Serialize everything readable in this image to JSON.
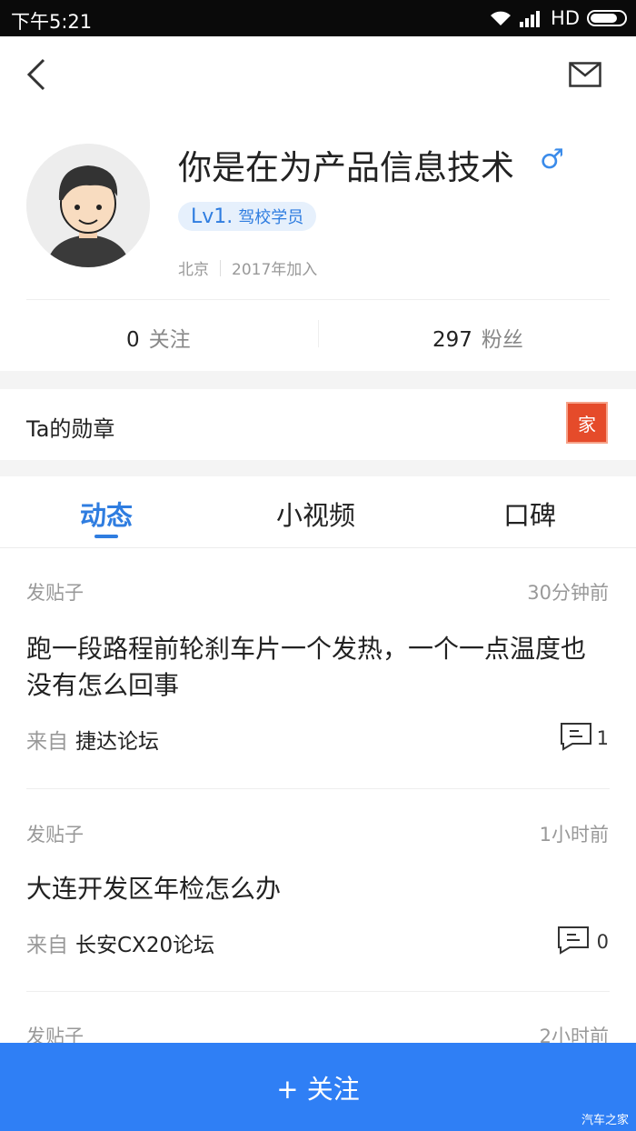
{
  "status": {
    "time": "下午5:21",
    "network": "HD"
  },
  "profile": {
    "username": "你是在为产品信息技术",
    "gender": "♂",
    "level": "Lv1.",
    "level_name": "驾校学员",
    "location": "北京",
    "joined": "2017年加入"
  },
  "stats": {
    "following_count": "0",
    "following_label": "关注",
    "fans_count": "297",
    "fans_label": "粉丝"
  },
  "badges": {
    "title": "Ta的勋章",
    "badge_text": "家"
  },
  "tabs": [
    {
      "label": "动态"
    },
    {
      "label": "小视频"
    },
    {
      "label": "口碑"
    }
  ],
  "posts": [
    {
      "type": "发贴子",
      "time": "30分钟前",
      "title": "跑一段路程前轮刹车片一个发热，一个一点温度也没有怎么回事",
      "from_label": "来自",
      "forum": "捷达论坛",
      "comments": "1"
    },
    {
      "type": "发贴子",
      "time": "1小时前",
      "title": "大连开发区年检怎么办",
      "from_label": "来自",
      "forum": "长安CX20论坛",
      "comments": "0"
    },
    {
      "type": "发贴子",
      "time": "2小时前"
    }
  ],
  "follow_button": "+ 关注",
  "watermark": "汽车之家",
  "colors": {
    "accent": "#2f7de0",
    "button": "#2f7ff5"
  }
}
